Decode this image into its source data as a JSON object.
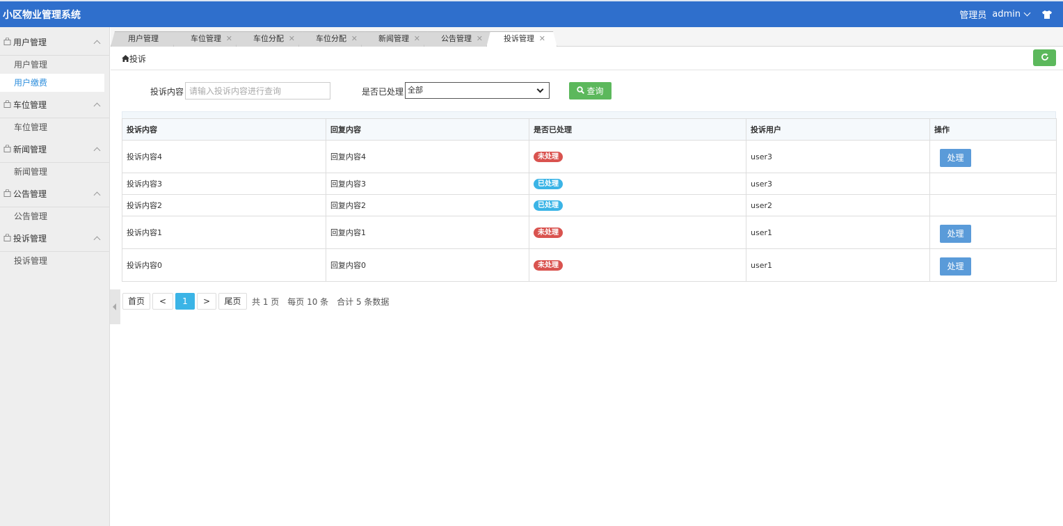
{
  "header": {
    "title": "小区物业管理系统",
    "role": "管理员",
    "username": "admin"
  },
  "sidebar": {
    "groups": [
      {
        "label": "用户管理",
        "items": [
          "用户管理",
          "用户缴费"
        ]
      },
      {
        "label": "车位管理",
        "items": [
          "车位管理"
        ]
      },
      {
        "label": "新闻管理",
        "items": [
          "新闻管理"
        ]
      },
      {
        "label": "公告管理",
        "items": [
          "公告管理"
        ]
      },
      {
        "label": "投诉管理",
        "items": [
          "投诉管理"
        ]
      }
    ],
    "active_item": "用户缴费"
  },
  "tabs": [
    "用户管理",
    "车位管理",
    "车位分配",
    "车位分配",
    "新闻管理",
    "公告管理",
    "投诉管理"
  ],
  "active_tab": "投诉管理",
  "breadcrumb": "投诉",
  "search": {
    "content_label": "投诉内容",
    "content_placeholder": "请输入投诉内容进行查询",
    "status_label": "是否已处理",
    "status_value": "全部",
    "button_label": "查询"
  },
  "table": {
    "headers": [
      "投诉内容",
      "回复内容",
      "是否已处理",
      "投诉用户",
      "操作"
    ],
    "rows": [
      {
        "content": "投诉内容4",
        "reply": "回复内容4",
        "status": "未处理",
        "user": "user3",
        "action": "处理"
      },
      {
        "content": "投诉内容3",
        "reply": "回复内容3",
        "status": "已处理",
        "user": "user3",
        "action": ""
      },
      {
        "content": "投诉内容2",
        "reply": "回复内容2",
        "status": "已处理",
        "user": "user2",
        "action": ""
      },
      {
        "content": "投诉内容1",
        "reply": "回复内容1",
        "status": "未处理",
        "user": "user1",
        "action": "处理"
      },
      {
        "content": "投诉内容0",
        "reply": "回复内容0",
        "status": "未处理",
        "user": "user1",
        "action": "处理"
      }
    ]
  },
  "pagination": {
    "first": "首页",
    "prev": "<",
    "current": "1",
    "next": ">",
    "last": "尾页",
    "total_pages": "共 1 页",
    "per_page": "每页 10 条",
    "total_records": "合计 5 条数据"
  },
  "colors": {
    "header_bg": "#2f6fcc",
    "success": "#5cb85c",
    "danger": "#d9534f",
    "info": "#3bb4e6",
    "primary": "#5a9bd9"
  }
}
